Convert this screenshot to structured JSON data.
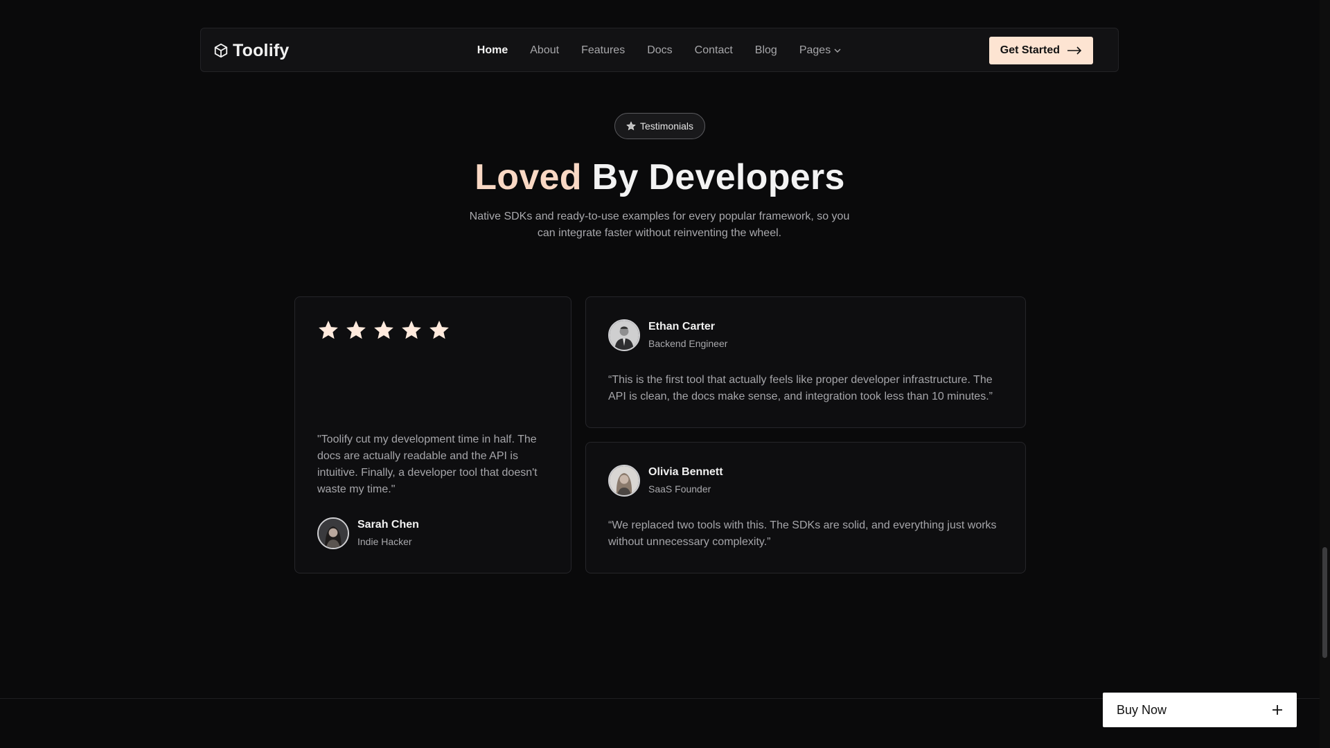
{
  "nav": {
    "brand": "Toolify",
    "links": [
      "Home",
      "About",
      "Features",
      "Docs",
      "Contact",
      "Blog"
    ],
    "pages_label": "Pages",
    "active": "Home",
    "cta_label": "Get Started"
  },
  "hero": {
    "badge": "Testimonials",
    "title_accent": "Loved",
    "title_rest": "By Developers",
    "subtitle": "Native SDKs and ready-to-use examples for every popular framework, so you can integrate faster without reinventing the wheel."
  },
  "testimonials": {
    "featured": {
      "rating": 5,
      "quote": "\"Toolify cut my development time in half. The docs are actually readable and the API is intuitive. Finally, a developer tool that doesn't waste my time.\"",
      "name": "Sarah Chen",
      "role": "Indie Hacker"
    },
    "items": [
      {
        "name": "Ethan Carter",
        "role": "Backend Engineer",
        "quote": "“This is the first tool that actually feels like proper developer infrastructure. The API is clean, the docs make sense, and integration took less than 10 minutes.”"
      },
      {
        "name": "Olivia Bennett",
        "role": "SaaS Founder",
        "quote": "“We replaced two tools with this. The SDKs are solid, and everything just works without unnecessary complexity.”"
      }
    ]
  },
  "footer": {
    "buy_label": "Buy Now"
  },
  "colors": {
    "accent": "#f9d8c4",
    "cta_bg": "#fde4d2",
    "background": "#0a0a0b"
  },
  "icons": {
    "brand": "cube-logo-icon",
    "pages": "chevron-down-icon",
    "cta": "arrow-right-icon",
    "badge": "star-outline-icon",
    "rating": "star-icon",
    "buy": "plus-icon"
  }
}
